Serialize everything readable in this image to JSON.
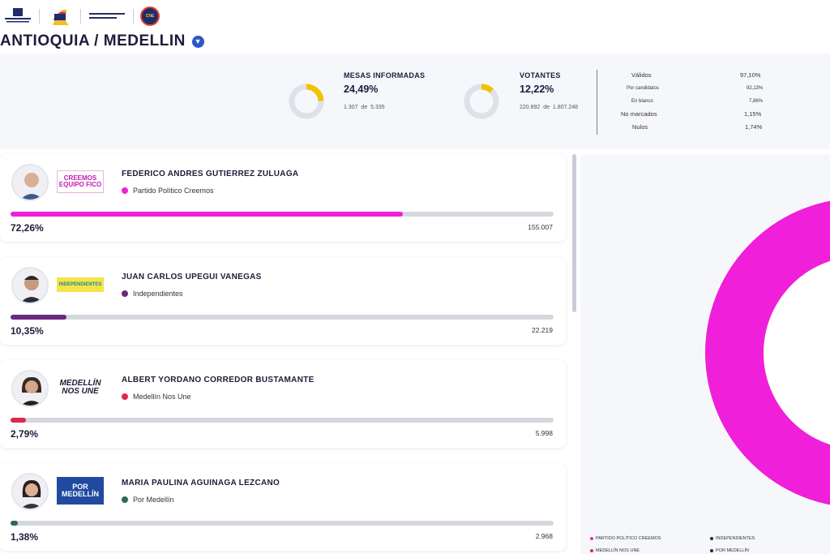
{
  "header": {
    "logos": [
      "Registraduría Nacional del Estado Civil",
      "Elecciones Territoriales 2023",
      "La democracia es de todos",
      "Consejo Nacional Electoral"
    ]
  },
  "title": "ANTIOQUIA / MEDELLIN",
  "stats": {
    "mesas": {
      "label": "MESAS INFORMADAS",
      "pct": "24,49%",
      "count": "1.307",
      "of_word": "de",
      "total": "5.335",
      "fraction": 0.2449
    },
    "votantes": {
      "label": "VOTANTES",
      "pct": "12,22%",
      "count": "220.892",
      "of_word": "de",
      "total": "1.807.248",
      "fraction": 0.1222
    },
    "breakdown": [
      {
        "label": "Válidos",
        "value": "97,10%"
      },
      {
        "label": "Por candidatos",
        "value": "92,13%"
      },
      {
        "label": "En blanco",
        "value": "7,86%"
      },
      {
        "label": "No marcados",
        "value": "1,15%"
      },
      {
        "label": "Nulos",
        "value": "1,74%"
      }
    ]
  },
  "candidates": [
    {
      "name": "FEDERICO ANDRES GUTIERREZ ZULUAGA",
      "party": "Partido Político Creemos",
      "party_logo": "CREEMOS EQUIPO FICO",
      "color": "#f01fd9",
      "pct": "72,26%",
      "fraction": 0.7226,
      "votes": "155.007"
    },
    {
      "name": "JUAN CARLOS UPEGUI VANEGAS",
      "party": "Independientes",
      "party_logo": "INDEPENDIENTES",
      "color": "#6a2a7e",
      "pct": "10,35%",
      "fraction": 0.1035,
      "votes": "22.219"
    },
    {
      "name": "ALBERT YORDANO CORREDOR BUSTAMANTE",
      "party": "Medellín Nos Une",
      "party_logo": "MEDELLÍN NOS UNE",
      "color": "#e0284e",
      "pct": "2,79%",
      "fraction": 0.0279,
      "votes": "5.998"
    },
    {
      "name": "MARIA PAULINA AGUINAGA LEZCANO",
      "party": "Por Medellín",
      "party_logo": "POR MEDELLÍN",
      "color": "#2e6b4d",
      "pct": "1,38%",
      "fraction": 0.0138,
      "votes": "2.968"
    }
  ],
  "chart_data": {
    "type": "pie",
    "labels": [
      "PARTIDO POLÍTICO CREEMOS",
      "INDEPENDIENTES",
      "MEDELLÍN NOS UNE",
      "POR MEDELLÍN"
    ],
    "values": [
      72.26,
      10.35,
      2.79,
      1.38
    ],
    "colors": [
      "#f01fd9",
      "#6a2a7e",
      "#e0284e",
      "#2e6b4d"
    ],
    "legend": [
      {
        "label": "PARTIDO POLÍTICO CREEMOS",
        "color": "#f01fd9"
      },
      {
        "label": "INDEPENDIENTES",
        "color": "#2a2346"
      },
      {
        "label": "MEDELLÍN NOS UNE",
        "color": "#e0284e"
      },
      {
        "label": "POR MEDELLÍN",
        "color": "#2a2346"
      }
    ]
  }
}
